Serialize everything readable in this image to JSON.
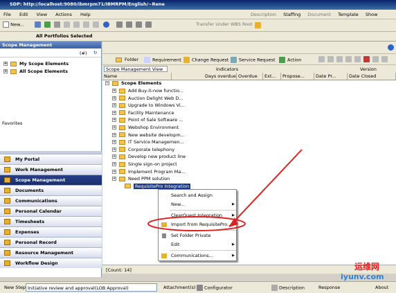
{
  "window": {
    "title": "SDP: http://localhost:9080/ibmrpm71/IBMRPM/English/~Rene",
    "top_right": [
      "Description",
      "Staffing",
      "Document",
      "Template",
      "Show"
    ]
  },
  "menu": [
    "File",
    "Edit",
    "View",
    "Actions",
    "Help"
  ],
  "toolbar": {
    "new_label": "New...",
    "transfer_label": "Transfer Under WBS Root"
  },
  "header": {
    "portfolios": "All Portfolios Selected"
  },
  "sidebar": {
    "pane_title": "Scope Management",
    "count_label": "(#)",
    "tree": [
      "My Scope Elements",
      "All Scope Elements"
    ],
    "favorites": "Favorites",
    "nav": [
      "My Portal",
      "Work Management",
      "Scope Management",
      "Documents",
      "Communications",
      "Personal Calendar",
      "Timesheets",
      "Expenses",
      "Personal Record",
      "Resource Management",
      "Workflow Design"
    ]
  },
  "main_toolbar": [
    "Folder",
    "Requirement",
    "Change Request",
    "Service Request",
    "Action"
  ],
  "view_select": "Scope Management View",
  "columns": {
    "group_indicators": "Indicators",
    "group_version": "Version",
    "name": "Name",
    "days_overdue": "Days overdue",
    "overdue": "Overdue",
    "ext": "Ext...",
    "propose": "Propose...",
    "date_pr": "Date Pr...",
    "date_closed": "Date Closed"
  },
  "tree_root": "Scope Elements",
  "tree_items": [
    "Add Buy-it-now functio...",
    "Auction Delight Web D...",
    "Upgrade to Windows Vi...",
    "Facility Maintenance",
    "Point of Sale Software ...",
    "Webshop Environment",
    "New website developm...",
    "IT Service Managemen...",
    "Corporate telephony",
    "Develop new product line",
    "Single sign-on project",
    "Implement Program Ma...",
    "Need PPM solution",
    "RequisitePro Integration"
  ],
  "context_menu": [
    "Search and Assign",
    "New...",
    "ClearQuest Integration",
    "Import from RequisitePro...",
    "Set Folder Private",
    "Edit",
    "Communications..."
  ],
  "count": "[Count: 14]",
  "statusbar": {
    "step_label": "New Step",
    "step_value": "Initiative review and approval(LOB Approval)",
    "attachments": "Attachment(s)",
    "configurator": "Configurator",
    "description": "Description",
    "response": "Response",
    "about": "About"
  },
  "watermark": {
    "cn": "运维网",
    "url": "iyunv.com"
  },
  "colors": {
    "title_bar": "#0a246a",
    "nav_active": "#1b2e6b",
    "annotation": "#e02020"
  }
}
